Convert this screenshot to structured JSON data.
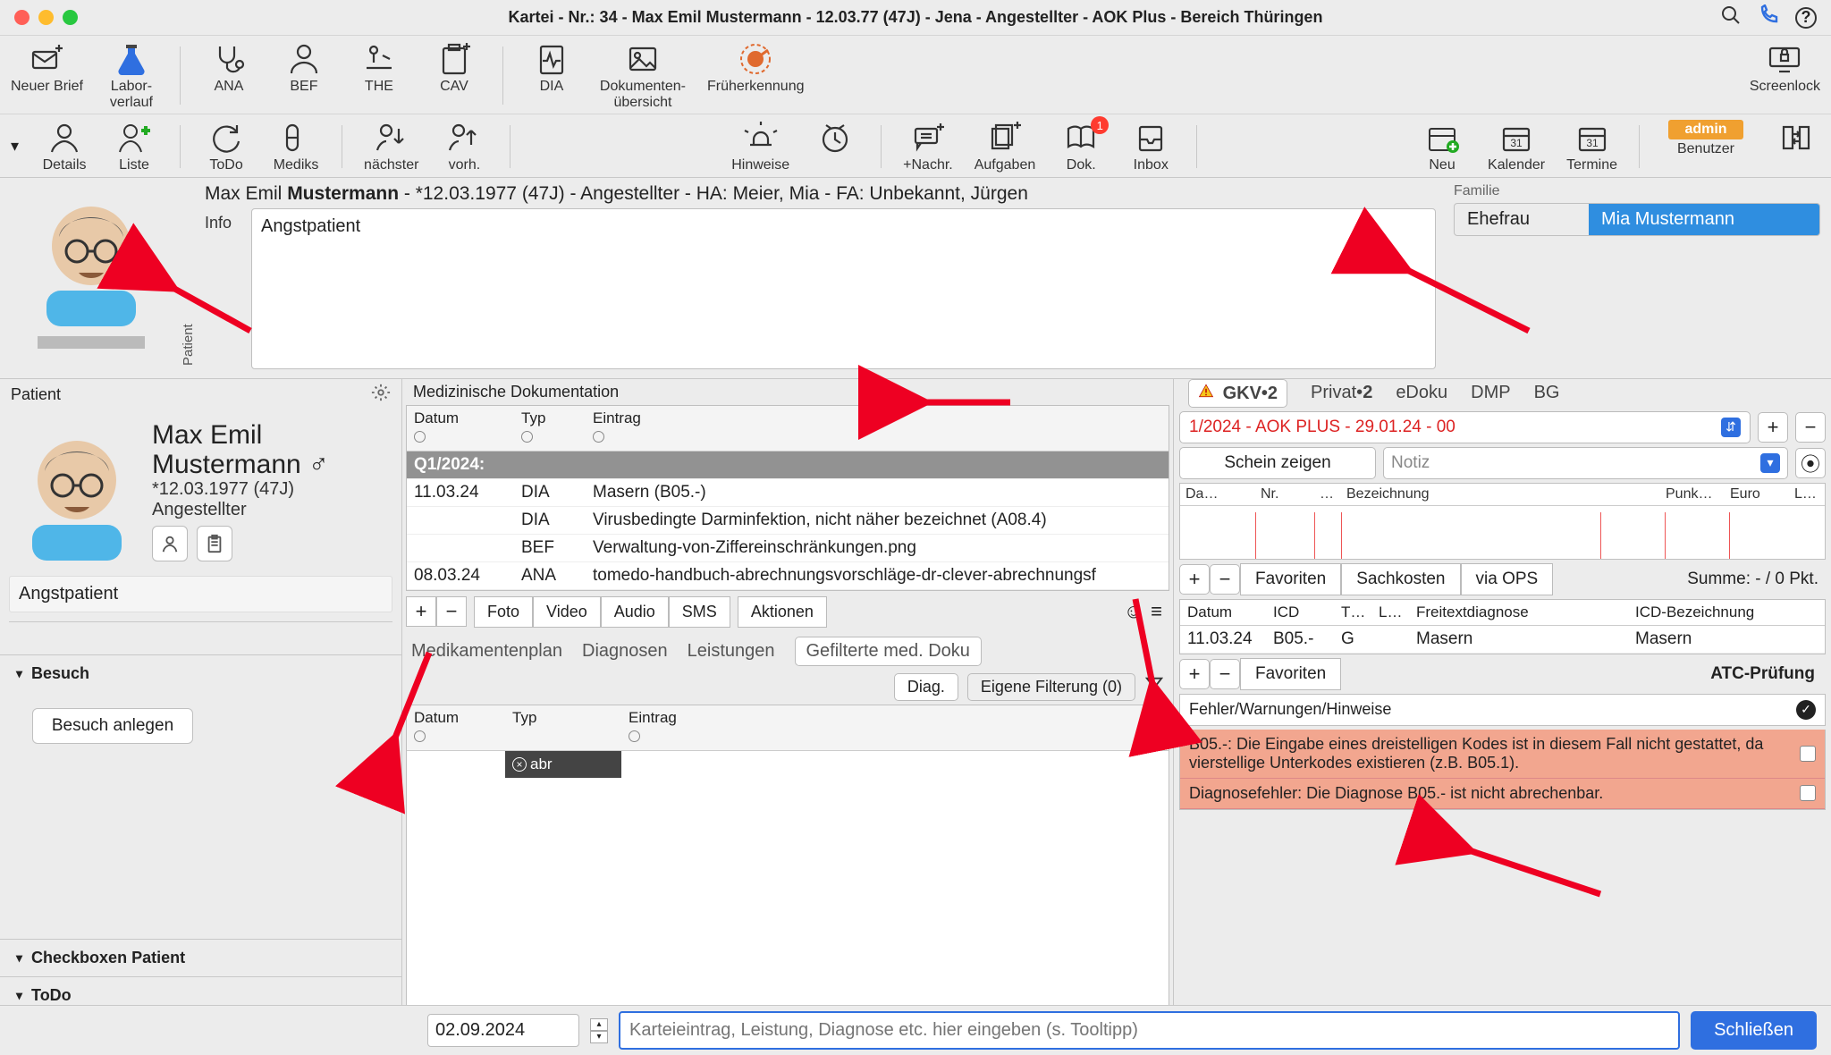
{
  "window": {
    "title": "Kartei - Nr.: 34 - Max Emil Mustermann - 12.03.77 (47J) - Jena - Angestellter - AOK Plus - Bereich Thüringen"
  },
  "titlebar_icons": {
    "search": "search",
    "phone": "phone",
    "help": "?"
  },
  "toolbar1": {
    "neuer_brief": "Neuer Brief",
    "laborverlauf": "Labor-\nverlauf",
    "ana": "ANA",
    "bef": "BEF",
    "the": "THE",
    "cav": "CAV",
    "dia": "DIA",
    "dokubersicht": "Dokumenten-\nübersicht",
    "frueh": "Früherkennung",
    "screenlock": "Screenlock"
  },
  "toolbar2": {
    "details": "Details",
    "liste": "Liste",
    "todo": "ToDo",
    "mediks": "Mediks",
    "naechster": "nächster",
    "vorh": "vorh.",
    "hinweise": "Hinweise",
    "nachr": "+Nachr.",
    "aufgaben": "Aufgaben",
    "dok": "Dok.",
    "dok_badge": "1",
    "inbox": "Inbox",
    "neu": "Neu",
    "kalender": "Kalender",
    "termine": "Termine",
    "user": "admin",
    "benutzer": "Benutzer"
  },
  "patient_strip": {
    "label": "Patient",
    "summary_pre": "Max Emil ",
    "summary_bold": "Mustermann",
    "summary_post": " - *12.03.1977 (47J) - Angestellter - HA: Meier, Mia - FA: Unbekannt, Jürgen",
    "info_label": "Info",
    "info_text": "Angstpatient",
    "familie_label": "Familie",
    "relation": "Ehefrau",
    "relative": "Mia Mustermann"
  },
  "left": {
    "header": "Patient",
    "name": "Max Emil\nMustermann ♂",
    "dob": "*12.03.1977 (47J)",
    "role": "Angestellter",
    "info": "Angstpatient",
    "acc_besuch": "Besuch",
    "visit_btn": "Besuch anlegen",
    "acc_checkbox": "Checkboxen Patient",
    "acc_todo": "ToDo"
  },
  "mid": {
    "title": "Medizinische Dokumentation",
    "cols": {
      "date": "Datum",
      "typ": "Typ",
      "entry": "Eintrag"
    },
    "group": "Q1/2024:",
    "rows": [
      {
        "date": "11.03.24",
        "typ": "DIA",
        "entry": "Masern (B05.-)"
      },
      {
        "date": "",
        "typ": "DIA",
        "entry": "Virusbedingte Darminfektion, nicht näher bezeichnet (A08.4)"
      },
      {
        "date": "",
        "typ": "BEF",
        "entry": "Verwaltung-von-Ziffereinschränkungen.png"
      },
      {
        "date": "08.03.24",
        "typ": "ANA",
        "entry": "tomedo-handbuch-abrechnungsvorschläge-dr-clever-abrechnungsf"
      }
    ],
    "seg": {
      "foto": "Foto",
      "video": "Video",
      "audio": "Audio",
      "sms": "SMS",
      "aktionen": "Aktionen"
    },
    "tabs": {
      "medplan": "Medikamentenplan",
      "diagnosen": "Diagnosen",
      "leistungen": "Leistungen",
      "gef": "Gefilterte med. Doku"
    },
    "filter": {
      "diag": "Diag.",
      "eigene": "Eigene Filterung (0)"
    },
    "grid2_cols": {
      "date": "Datum",
      "typ": "Typ",
      "entry": "Eintrag"
    },
    "grid2_filter": "abr"
  },
  "right": {
    "tabs": {
      "gkv": "GKV",
      "gkv_badge": "2",
      "privat": "Privat",
      "privat_badge": "2",
      "edoku": "eDoku",
      "dmp": "DMP",
      "bg": "BG"
    },
    "case": "1/2024 - AOK PLUS - 29.01.24 - 00",
    "schein": "Schein zeigen",
    "notiz_ph": "Notiz",
    "mg_cols": {
      "c1": "Da…",
      "c2": "Nr.",
      "c3": "…",
      "c4": "Bezeichnung",
      "c5": "Punk…",
      "c6": "Euro",
      "c7": "Le…"
    },
    "sum_btns": {
      "fav": "Favoriten",
      "sach": "Sachkosten",
      "ops": "via OPS"
    },
    "sum": "Summe: - / 0 Pkt.",
    "dg_cols": {
      "c1": "Datum",
      "c2": "ICD",
      "c3": "T…",
      "c4": "L…",
      "c5": "Freitextdiagnose",
      "c6": "ICD-Bezeichnung"
    },
    "dg_row": {
      "date": "11.03.24",
      "icd": "B05.-",
      "t": "G",
      "l": "",
      "free": "Masern",
      "bez": "Masern"
    },
    "fav2": "Favoriten",
    "atc": "ATC-Prüfung",
    "err_head": "Fehler/Warnungen/Hinweise",
    "err1": "B05.-: Die Eingabe eines dreistelligen Kodes ist in diesem Fall nicht gestattet, da vierstellige Unterkodes existieren (z.B. B05.1).",
    "err2": "Diagnosefehler: Die Diagnose B05.- ist nicht abrechenbar."
  },
  "bottom": {
    "date": "02.09.2024",
    "placeholder": "Karteieintrag, Leistung, Diagnose etc. hier eingeben (s. Tooltipp)",
    "close": "Schließen"
  }
}
